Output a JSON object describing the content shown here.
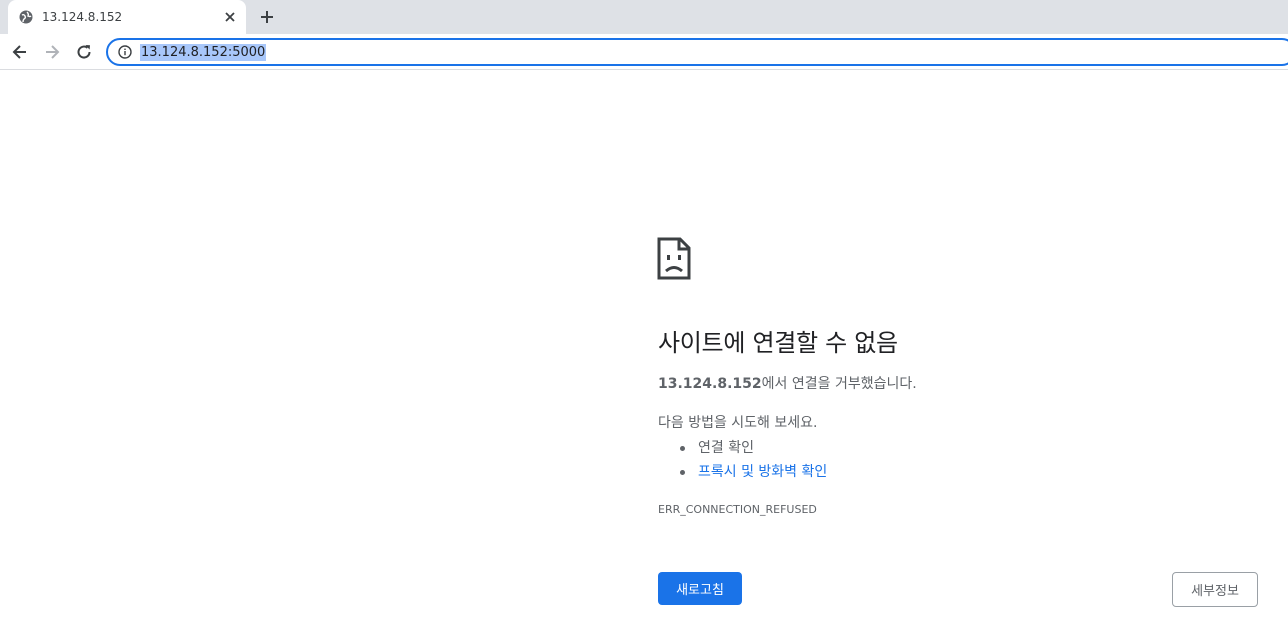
{
  "tab": {
    "title": "13.124.8.152",
    "favicon": "globe-icon",
    "close_icon": "close-icon"
  },
  "newtab_icon": "plus-icon",
  "toolbar": {
    "back_icon": "arrow-left-icon",
    "forward_icon": "arrow-right-icon",
    "reload_icon": "reload-icon",
    "info_icon": "info-icon",
    "url": "13.124.8.152:5000"
  },
  "error": {
    "icon": "sad-page-icon",
    "title": "사이트에 연결할 수 없음",
    "host": "13.124.8.152",
    "desc_suffix": "에서 연결을 거부했습니다.",
    "try_label": "다음 방법을 시도해 보세요.",
    "suggestions": [
      {
        "label": "연결 확인",
        "is_link": false
      },
      {
        "label": "프록시 및 방화벽 확인",
        "is_link": true
      }
    ],
    "code": "ERR_CONNECTION_REFUSED",
    "reload_label": "새로고침",
    "details_label": "세부정보"
  },
  "colors": {
    "accent": "#1a73e8",
    "tabstrip": "#dee1e6",
    "url_selection": "#a8c7fa",
    "secondary_text": "#5f6368"
  }
}
